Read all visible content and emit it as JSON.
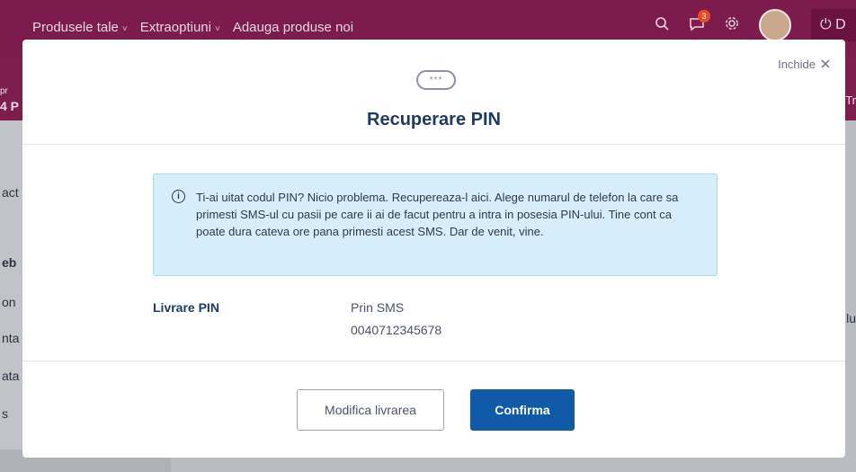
{
  "topbar": {
    "nav": [
      {
        "label": "Produsele tale",
        "has_chevron": true
      },
      {
        "label": "Extraoptiuni",
        "has_chevron": true
      },
      {
        "label": "Adauga produse noi",
        "has_chevron": false
      }
    ],
    "notification_count": "3",
    "logout_label": "D",
    "icons": [
      "search-icon",
      "chat-icon",
      "gear-icon",
      "power-icon"
    ]
  },
  "background": {
    "bar_left_small": "pr",
    "bar_left_big": "4 P",
    "bar_right": "Tr",
    "left_items": [
      "act",
      "eb",
      "on",
      "nta",
      "ata",
      "s"
    ],
    "right_item": "lu"
  },
  "modal": {
    "close_label": "Inchide",
    "close_icon": "close-icon",
    "pin_glyph": "***",
    "title": "Recuperare PIN",
    "info_text": "Ti-ai uitat codul PIN? Nicio problema. Recupereaza-l aici. Alege numarul de telefon la care sa primesti SMS-ul cu pasii pe care ii ai de facut pentru a intra in posesia PIN-ului. Tine cont ca poate dura cateva ore pana primesti acest SMS. Dar de venit, vine.",
    "delivery_label": "Livrare PIN",
    "delivery_method": "Prin SMS",
    "delivery_phone": "0040712345678",
    "secondary_button": "Modifica livrarea",
    "primary_button": "Confirma"
  },
  "colors": {
    "brand": "#7b1c4c",
    "primary": "#0f5ba7",
    "title": "#1f3b62",
    "info_bg": "#d5eef9"
  }
}
